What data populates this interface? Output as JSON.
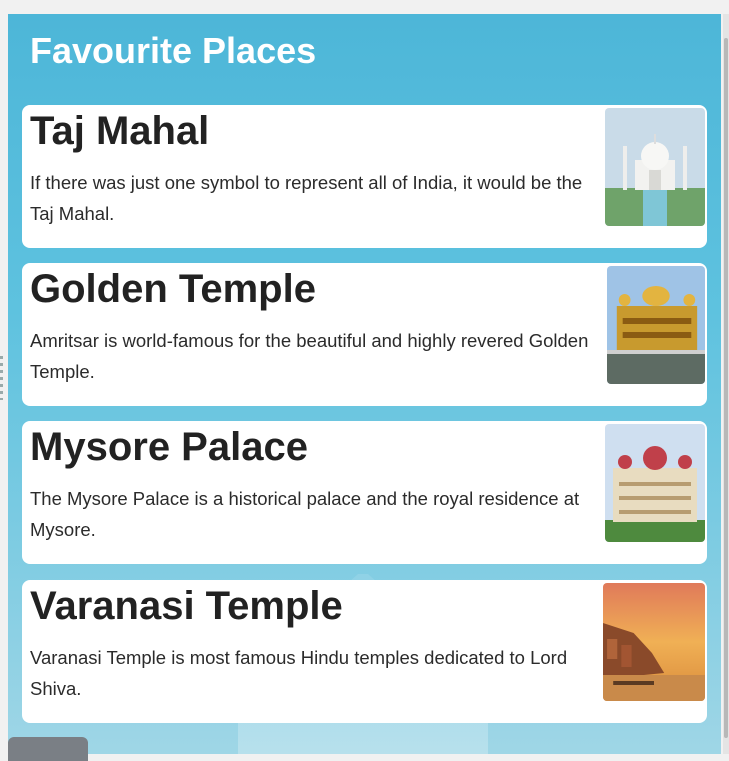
{
  "page": {
    "title": "Favourite Places"
  },
  "places": [
    {
      "name": "Taj Mahal",
      "description": "If there was just one symbol to represent all of India, it would be the Taj Mahal.",
      "image_icon": "taj-mahal-photo"
    },
    {
      "name": "Golden Temple",
      "description": "Amritsar is world-famous for the beautiful and highly revered Golden Temple.",
      "image_icon": "golden-temple-photo"
    },
    {
      "name": "Mysore Palace",
      "description": "The Mysore Palace is a historical palace and the royal residence at Mysore.",
      "image_icon": "mysore-palace-photo"
    },
    {
      "name": "Varanasi Temple",
      "description": "Varanasi Temple is most famous Hindu temples dedicated to Lord Shiva.",
      "image_icon": "varanasi-ghat-photo"
    }
  ],
  "colors": {
    "background": "#4db6d8",
    "card": "#ffffff",
    "title_text": "#ffffff",
    "heading_text": "#222222"
  }
}
